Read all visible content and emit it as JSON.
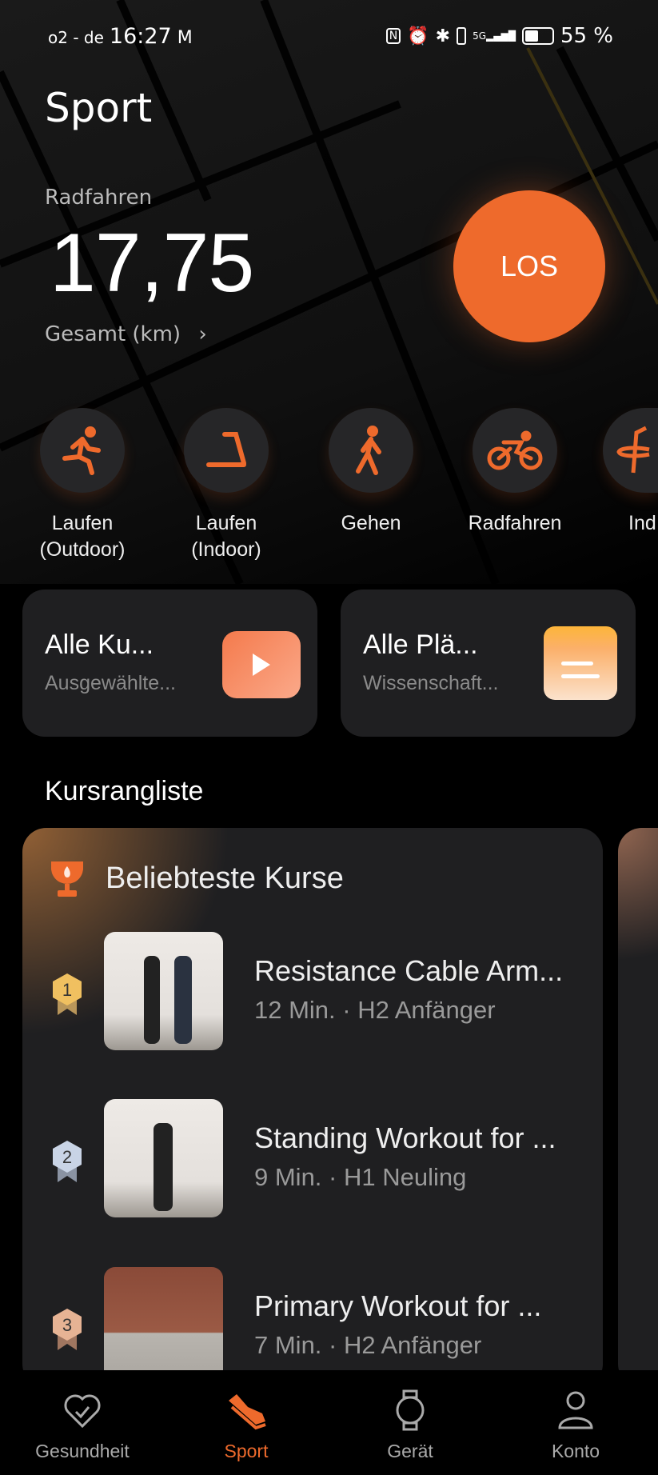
{
  "status_bar": {
    "carrier": "o2 - de",
    "time": "16:27",
    "battery": "55 %",
    "icons": [
      "gmail-icon",
      "nfc-icon",
      "alarm-icon",
      "bluetooth-icon",
      "vibrate-icon",
      "5g-signal-icon",
      "battery-icon"
    ]
  },
  "header": {
    "title": "Sport",
    "activity_label": "Radfahren",
    "total_value": "17,75",
    "total_label": "Gesamt (km)",
    "go_button": "LOS"
  },
  "accent_color": "#ee6a2c",
  "sports": [
    {
      "label": "Laufen\n(Outdoor)",
      "icon": "running-icon"
    },
    {
      "label": "Laufen\n(Indoor)",
      "icon": "treadmill-icon"
    },
    {
      "label": "Gehen",
      "icon": "walking-icon"
    },
    {
      "label": "Radfahren",
      "icon": "cycling-icon"
    },
    {
      "label": "Ind",
      "icon": "hula-hoop-icon"
    }
  ],
  "quick_cards": [
    {
      "title": "Alle Ku...",
      "subtitle": "Ausgewählte...",
      "icon": "play-icon"
    },
    {
      "title": "Alle Plä...",
      "subtitle": "Wissenschaft...",
      "icon": "calendar-icon"
    }
  ],
  "ranking": {
    "section_title": "Kursrangliste",
    "card_title": "Beliebteste Kurse",
    "items": [
      {
        "rank": "1",
        "title": "Resistance Cable Arm...",
        "meta": "12 Min. · H2 Anfänger"
      },
      {
        "rank": "2",
        "title": "Standing Workout for ...",
        "meta": "9 Min. · H1 Neuling"
      },
      {
        "rank": "3",
        "title": "Primary Workout for ...",
        "meta": "7 Min. · H2 Anfänger"
      }
    ]
  },
  "nav": [
    {
      "label": "Gesundheit"
    },
    {
      "label": "Sport",
      "active": true
    },
    {
      "label": "Gerät"
    },
    {
      "label": "Konto"
    }
  ]
}
